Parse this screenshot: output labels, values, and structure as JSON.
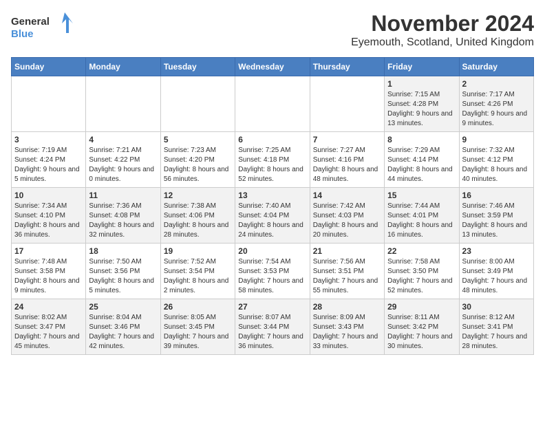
{
  "header": {
    "logo_general": "General",
    "logo_blue": "Blue",
    "title": "November 2024",
    "subtitle": "Eyemouth, Scotland, United Kingdom"
  },
  "calendar": {
    "days_of_week": [
      "Sunday",
      "Monday",
      "Tuesday",
      "Wednesday",
      "Thursday",
      "Friday",
      "Saturday"
    ],
    "weeks": [
      [
        {
          "day": "",
          "info": ""
        },
        {
          "day": "",
          "info": ""
        },
        {
          "day": "",
          "info": ""
        },
        {
          "day": "",
          "info": ""
        },
        {
          "day": "",
          "info": ""
        },
        {
          "day": "1",
          "info": "Sunrise: 7:15 AM\nSunset: 4:28 PM\nDaylight: 9 hours and 13 minutes."
        },
        {
          "day": "2",
          "info": "Sunrise: 7:17 AM\nSunset: 4:26 PM\nDaylight: 9 hours and 9 minutes."
        }
      ],
      [
        {
          "day": "3",
          "info": "Sunrise: 7:19 AM\nSunset: 4:24 PM\nDaylight: 9 hours and 5 minutes."
        },
        {
          "day": "4",
          "info": "Sunrise: 7:21 AM\nSunset: 4:22 PM\nDaylight: 9 hours and 0 minutes."
        },
        {
          "day": "5",
          "info": "Sunrise: 7:23 AM\nSunset: 4:20 PM\nDaylight: 8 hours and 56 minutes."
        },
        {
          "day": "6",
          "info": "Sunrise: 7:25 AM\nSunset: 4:18 PM\nDaylight: 8 hours and 52 minutes."
        },
        {
          "day": "7",
          "info": "Sunrise: 7:27 AM\nSunset: 4:16 PM\nDaylight: 8 hours and 48 minutes."
        },
        {
          "day": "8",
          "info": "Sunrise: 7:29 AM\nSunset: 4:14 PM\nDaylight: 8 hours and 44 minutes."
        },
        {
          "day": "9",
          "info": "Sunrise: 7:32 AM\nSunset: 4:12 PM\nDaylight: 8 hours and 40 minutes."
        }
      ],
      [
        {
          "day": "10",
          "info": "Sunrise: 7:34 AM\nSunset: 4:10 PM\nDaylight: 8 hours and 36 minutes."
        },
        {
          "day": "11",
          "info": "Sunrise: 7:36 AM\nSunset: 4:08 PM\nDaylight: 8 hours and 32 minutes."
        },
        {
          "day": "12",
          "info": "Sunrise: 7:38 AM\nSunset: 4:06 PM\nDaylight: 8 hours and 28 minutes."
        },
        {
          "day": "13",
          "info": "Sunrise: 7:40 AM\nSunset: 4:04 PM\nDaylight: 8 hours and 24 minutes."
        },
        {
          "day": "14",
          "info": "Sunrise: 7:42 AM\nSunset: 4:03 PM\nDaylight: 8 hours and 20 minutes."
        },
        {
          "day": "15",
          "info": "Sunrise: 7:44 AM\nSunset: 4:01 PM\nDaylight: 8 hours and 16 minutes."
        },
        {
          "day": "16",
          "info": "Sunrise: 7:46 AM\nSunset: 3:59 PM\nDaylight: 8 hours and 13 minutes."
        }
      ],
      [
        {
          "day": "17",
          "info": "Sunrise: 7:48 AM\nSunset: 3:58 PM\nDaylight: 8 hours and 9 minutes."
        },
        {
          "day": "18",
          "info": "Sunrise: 7:50 AM\nSunset: 3:56 PM\nDaylight: 8 hours and 5 minutes."
        },
        {
          "day": "19",
          "info": "Sunrise: 7:52 AM\nSunset: 3:54 PM\nDaylight: 8 hours and 2 minutes."
        },
        {
          "day": "20",
          "info": "Sunrise: 7:54 AM\nSunset: 3:53 PM\nDaylight: 7 hours and 58 minutes."
        },
        {
          "day": "21",
          "info": "Sunrise: 7:56 AM\nSunset: 3:51 PM\nDaylight: 7 hours and 55 minutes."
        },
        {
          "day": "22",
          "info": "Sunrise: 7:58 AM\nSunset: 3:50 PM\nDaylight: 7 hours and 52 minutes."
        },
        {
          "day": "23",
          "info": "Sunrise: 8:00 AM\nSunset: 3:49 PM\nDaylight: 7 hours and 48 minutes."
        }
      ],
      [
        {
          "day": "24",
          "info": "Sunrise: 8:02 AM\nSunset: 3:47 PM\nDaylight: 7 hours and 45 minutes."
        },
        {
          "day": "25",
          "info": "Sunrise: 8:04 AM\nSunset: 3:46 PM\nDaylight: 7 hours and 42 minutes."
        },
        {
          "day": "26",
          "info": "Sunrise: 8:05 AM\nSunset: 3:45 PM\nDaylight: 7 hours and 39 minutes."
        },
        {
          "day": "27",
          "info": "Sunrise: 8:07 AM\nSunset: 3:44 PM\nDaylight: 7 hours and 36 minutes."
        },
        {
          "day": "28",
          "info": "Sunrise: 8:09 AM\nSunset: 3:43 PM\nDaylight: 7 hours and 33 minutes."
        },
        {
          "day": "29",
          "info": "Sunrise: 8:11 AM\nSunset: 3:42 PM\nDaylight: 7 hours and 30 minutes."
        },
        {
          "day": "30",
          "info": "Sunrise: 8:12 AM\nSunset: 3:41 PM\nDaylight: 7 hours and 28 minutes."
        }
      ]
    ]
  }
}
